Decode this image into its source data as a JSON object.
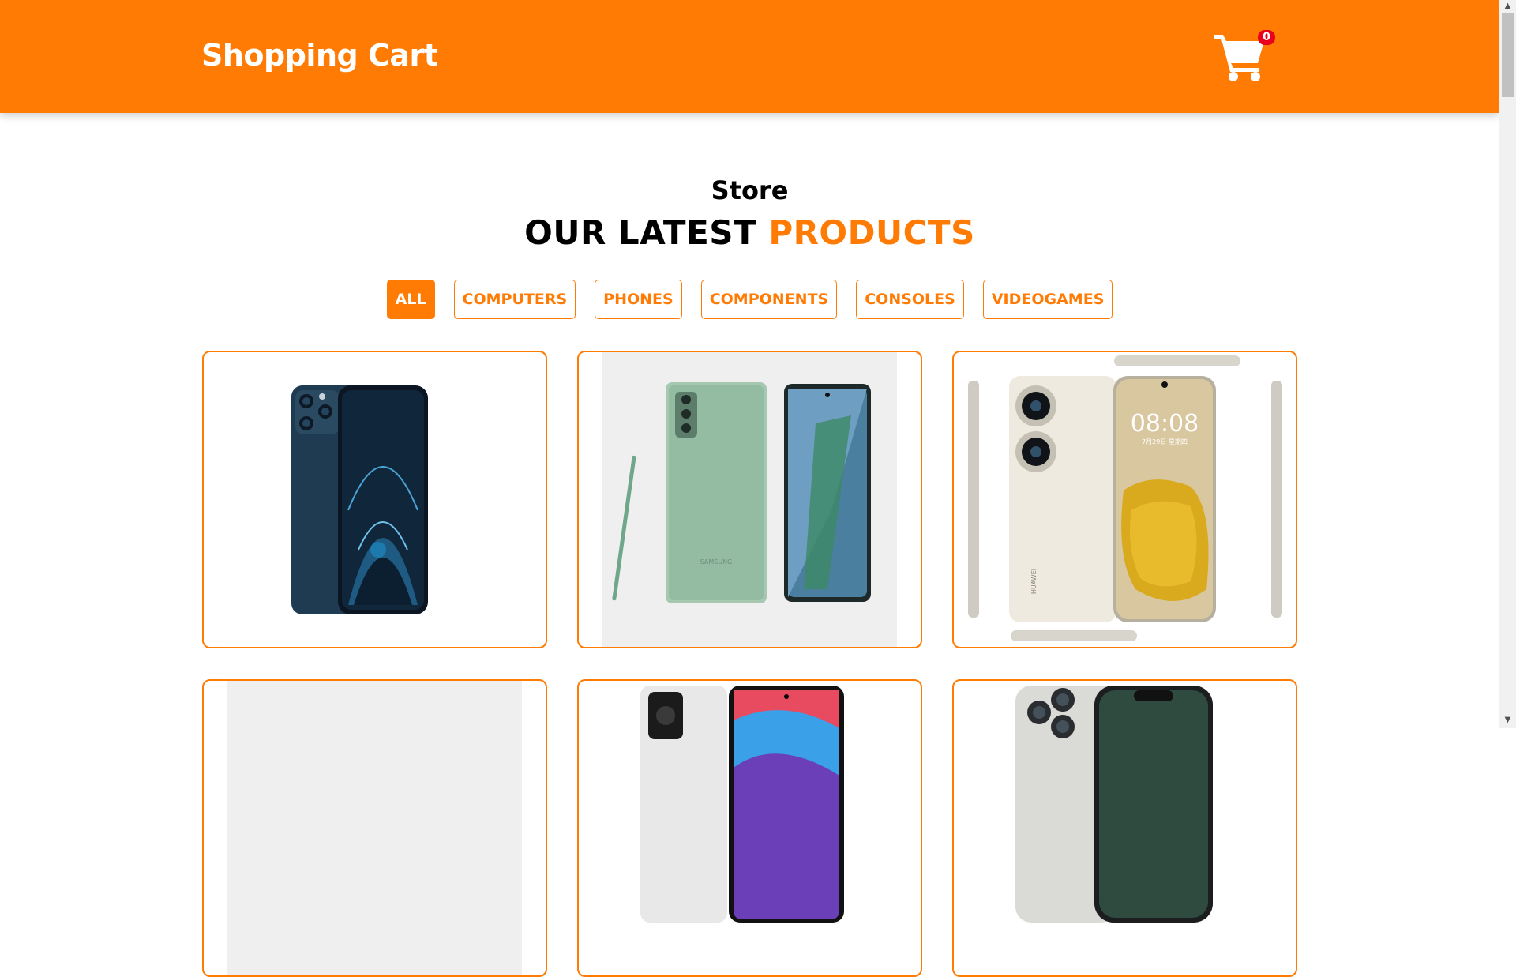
{
  "header": {
    "brand": "Shopping Cart",
    "cart_icon": "shopping-cart-icon",
    "cart_count": "0",
    "background": "#ff7b04",
    "badge_color": "#e8001c"
  },
  "section": {
    "subtitle": "Store",
    "title_plain": "OUR LATEST",
    "title_accent": "PRODUCTS"
  },
  "filters": [
    {
      "label": "ALL",
      "active": true
    },
    {
      "label": "COMPUTERS"
    },
    {
      "label": "PHONES"
    },
    {
      "label": "COMPONENTS"
    },
    {
      "label": "CONSOLES"
    },
    {
      "label": "VIDEOGAMES"
    }
  ],
  "products": [
    {
      "image": "iphone-12-pro-blue",
      "screen_text": ""
    },
    {
      "image": "samsung-galaxy-note-20-green",
      "brand_mark": "SAMSUNG"
    },
    {
      "image": "huawei-p50-pro-gold",
      "clock": "08:08",
      "date": "7月29日 星期四",
      "brand_mark": "HUAWEI"
    },
    {
      "image": "product-placeholder"
    },
    {
      "image": "realme-phone"
    },
    {
      "image": "iphone-13-pro"
    }
  ],
  "colors": {
    "accent": "#ff7b04",
    "text": "#000000"
  }
}
